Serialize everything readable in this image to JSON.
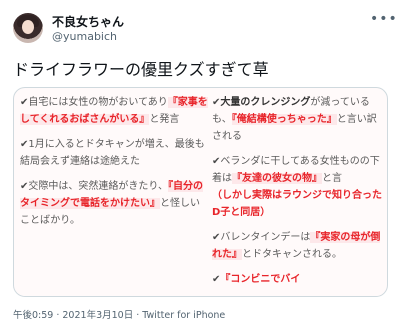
{
  "user": {
    "display_name": "不良女ちゃん",
    "handle": "@yumabich"
  },
  "more_glyph": "•••",
  "tweet_text": "ドライフラワーの優里クズすぎて草",
  "image": {
    "left": [
      {
        "check": "✔",
        "text1": "自宅には女性の物がおいてあり",
        "red": "『家事をしてくれるおばさんがいる』",
        "text2": "と発言"
      },
      {
        "check": "✔",
        "text1": "1月に入るとドタキャンが増え、最後も結局会えず連絡は途絶えた",
        "red": "",
        "text2": ""
      },
      {
        "check": "✔",
        "text1": "交際中は、突然連絡がきたり、",
        "red": "『自分のタイミングで電話をかけたい』",
        "text2": "と怪しいことばかり。"
      }
    ],
    "right": [
      {
        "check": "✔",
        "bold": "大量のクレンジング",
        "text1": "が減っているも、",
        "red": "『俺結構使っちゃった』",
        "text2": "と言い訳される"
      },
      {
        "check": "✔",
        "bold": "",
        "text1": "ベランダに干してある女性ものの下着は",
        "red": "『友達の彼女の物』",
        "text2": "と言",
        "red2": "（しかし実際はラウンジで知り合ったD子と同居）"
      },
      {
        "check": "✔",
        "bold": "",
        "text1": "バレンタインデーは",
        "red": "『実家の母が倒れた』",
        "text2": "とドタキャンされる。"
      },
      {
        "check": "✔",
        "bold": "",
        "text1": "",
        "red": "『コンビニでバイ",
        "text2": ""
      }
    ]
  },
  "timestamp": "午後0:59 · 2021年3月10日 · Twitter for iPhone"
}
